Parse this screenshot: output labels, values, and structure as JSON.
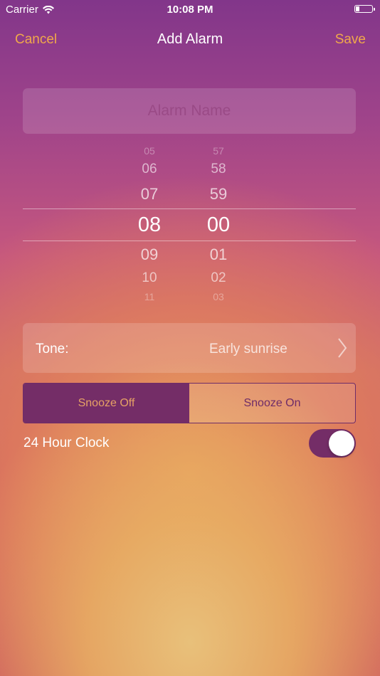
{
  "status_bar": {
    "carrier": "Carrier",
    "time": "10:08 PM",
    "wifi_icon": "wifi-icon",
    "battery_icon": "battery-icon"
  },
  "nav": {
    "cancel": "Cancel",
    "title": "Add Alarm",
    "save": "Save"
  },
  "alarm_name": {
    "placeholder": "Alarm Name",
    "value": ""
  },
  "time_picker": {
    "hours": [
      "05",
      "06",
      "07",
      "08",
      "09",
      "10",
      "11"
    ],
    "minutes": [
      "57",
      "58",
      "59",
      "00",
      "01",
      "02",
      "03"
    ],
    "selected_hour": "08",
    "selected_minute": "00"
  },
  "tone": {
    "label": "Tone:",
    "value": "Early sunrise",
    "chevron_icon": "chevron-right-icon"
  },
  "snooze": {
    "options": [
      "Snooze Off",
      "Snooze On"
    ],
    "selected": "Snooze Off"
  },
  "clock_24h": {
    "label": "24 Hour Clock",
    "enabled": true
  },
  "colors": {
    "accent": "#f0a84a",
    "segment_selected": "#742d67",
    "gradient_top": "#82368a",
    "gradient_bottom": "#e8c07a"
  }
}
